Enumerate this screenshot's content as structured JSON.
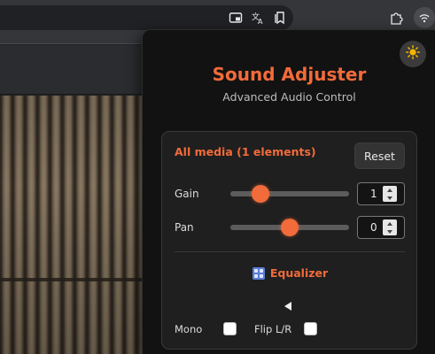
{
  "browser": {
    "toolbar_icons": [
      "screen-cast-icon",
      "translate-icon",
      "reading-list-icon",
      "extensions-puzzle-icon",
      "sound-adjuster-extension-icon"
    ]
  },
  "popup": {
    "title": "Sound Adjuster",
    "subtitle": "Advanced Audio Control",
    "theme_toggle_icon": "sun-icon",
    "accent_color": "#f26b3a",
    "media": {
      "label": "All media (1 elements)",
      "reset_label": "Reset"
    },
    "controls": [
      {
        "label": "Gain",
        "value": "1",
        "slider_fraction": 0.25
      },
      {
        "label": "Pan",
        "value": "0",
        "slider_fraction": 0.5
      }
    ],
    "equalizer": {
      "label": "Equalizer",
      "icon": "equalizer-grid-icon",
      "expand_icon": "triangle-left-icon"
    },
    "options": [
      {
        "label": "Mono",
        "checked": false
      },
      {
        "label": "Flip L/R",
        "checked": false
      }
    ]
  }
}
